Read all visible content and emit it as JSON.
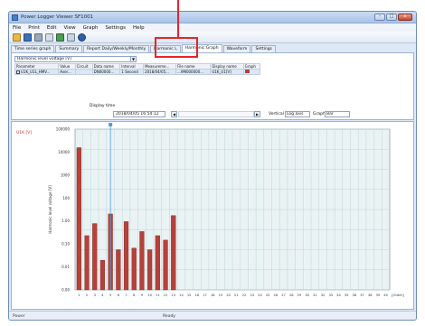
{
  "window": {
    "title": "Power Logger Viewer SF1001"
  },
  "menu": [
    "File",
    "Print",
    "Edit",
    "View",
    "Graph",
    "Settings",
    "Help"
  ],
  "toolbar": {
    "icons": [
      "open-icon",
      "save-icon",
      "print-icon",
      "copy-icon",
      "graph-icon",
      "zoom-icon",
      "info-icon"
    ]
  },
  "tabs": [
    "Time series graph",
    "Summary",
    "Report Daily/Weekly/Monthly",
    "Harmonic L",
    "Harmonic Graph",
    "Waveform",
    "Settings"
  ],
  "active_tab": "Harmonic Graph",
  "param_select": {
    "value": "Harmonic level voltage [V]"
  },
  "table": {
    "headers": [
      "Parameter",
      "Value",
      "Circuit",
      "Data name",
      "Interval",
      "Measureme...",
      "File name",
      "Display name",
      "Graph"
    ],
    "row": [
      "U1K_U1L_HMV...",
      "Aver...",
      "",
      "DN00000...",
      "1 Second",
      "2018/04/05...",
      "...9M000000...",
      "U1K_U1[V]",
      ""
    ]
  },
  "display_time": {
    "label": "Display time",
    "value": "2018/04/05  16:54:12"
  },
  "scroll": {
    "left": "◀",
    "right": "▶"
  },
  "vertical": {
    "label": "Vertical",
    "value": "Log axis"
  },
  "graph": {
    "label": "Graph",
    "value": "Bar"
  },
  "status": {
    "left": "Power",
    "mid": "Ready"
  },
  "colors": {
    "bar": "#b7413a",
    "marker": "#4f9ed9",
    "highlight": "#e8242a"
  },
  "chart_data": {
    "type": "bar",
    "title": "",
    "unit_label": "U1K [V]",
    "ylabel": "Harmonic level voltage [V]",
    "xlabel": "[Order]",
    "y_scale": "log",
    "ylim": [
      0.001,
      100000
    ],
    "yticks": [
      "100000",
      "10000",
      "1000",
      "100",
      "1.00",
      "0.10",
      "0.01",
      "0.00"
    ],
    "categories": [
      "1",
      "2",
      "3",
      "4",
      "5",
      "6",
      "7",
      "8",
      "9",
      "10",
      "11",
      "12",
      "13",
      "14",
      "15",
      "16",
      "17",
      "18",
      "19",
      "20",
      "21",
      "22",
      "23",
      "24",
      "25",
      "26",
      "27",
      "28",
      "29",
      "30",
      "31",
      "32",
      "33",
      "34",
      "35",
      "36",
      "37",
      "38",
      "39",
      "40"
    ],
    "values": [
      12000,
      0.5,
      2,
      0.03,
      6,
      0.1,
      2.5,
      0.12,
      0.8,
      0.1,
      0.5,
      0.3,
      5
    ],
    "marker_order": 5,
    "grid": true
  }
}
